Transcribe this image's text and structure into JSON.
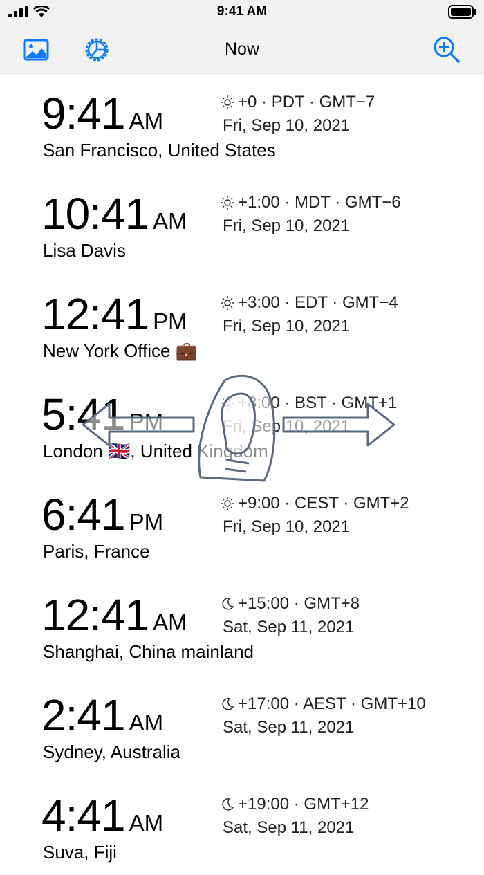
{
  "status_bar": {
    "time": "9:41 AM"
  },
  "nav": {
    "title": "Now",
    "icons": [
      "photo-icon",
      "gear-icon",
      "zoom-in-icon"
    ]
  },
  "entries": [
    {
      "time": "9:41",
      "ampm": "AM",
      "icon": "sun",
      "offset": "+0 · PDT · GMT−7",
      "date": "Fri, Sep 10, 2021",
      "city": "San Francisco, United States"
    },
    {
      "time": "10:41",
      "ampm": "AM",
      "icon": "sun",
      "offset": "+1:00 · MDT · GMT−6",
      "date": "Fri, Sep 10, 2021",
      "city": "Lisa Davis"
    },
    {
      "time": "12:41",
      "ampm": "PM",
      "icon": "sun",
      "offset": "+3:00 · EDT · GMT−4",
      "date": "Fri, Sep 10, 2021",
      "city": "New York Office 💼"
    },
    {
      "time": "5:41",
      "ampm": "PM",
      "icon": "sun",
      "offset": "+8:00 · BST · GMT+1",
      "date": "Fri, Sep 10, 2021",
      "city": "London 🇬🇧, United Kingdom"
    },
    {
      "time": "6:41",
      "ampm": "PM",
      "icon": "sun",
      "offset": "+9:00 · CEST · GMT+2",
      "date": "Fri, Sep 10, 2021",
      "city": "Paris, France"
    },
    {
      "time": "12:41",
      "ampm": "AM",
      "icon": "moon",
      "offset": "+15:00 · GMT+8",
      "date": "Sat, Sep 11, 2021",
      "city": "Shanghai, China mainland"
    },
    {
      "time": "2:41",
      "ampm": "AM",
      "icon": "moon",
      "offset": "+17:00 · AEST · GMT+10",
      "date": "Sat, Sep 11, 2021",
      "city": "Sydney, Australia"
    },
    {
      "time": "4:41",
      "ampm": "AM",
      "icon": "moon",
      "offset": "+19:00 · GMT+12",
      "date": "Sat, Sep 11, 2021",
      "city": "Suva, Fiji"
    }
  ],
  "colors": {
    "accent": "#0a7aff",
    "bar_bg": "#f2f2f2"
  }
}
